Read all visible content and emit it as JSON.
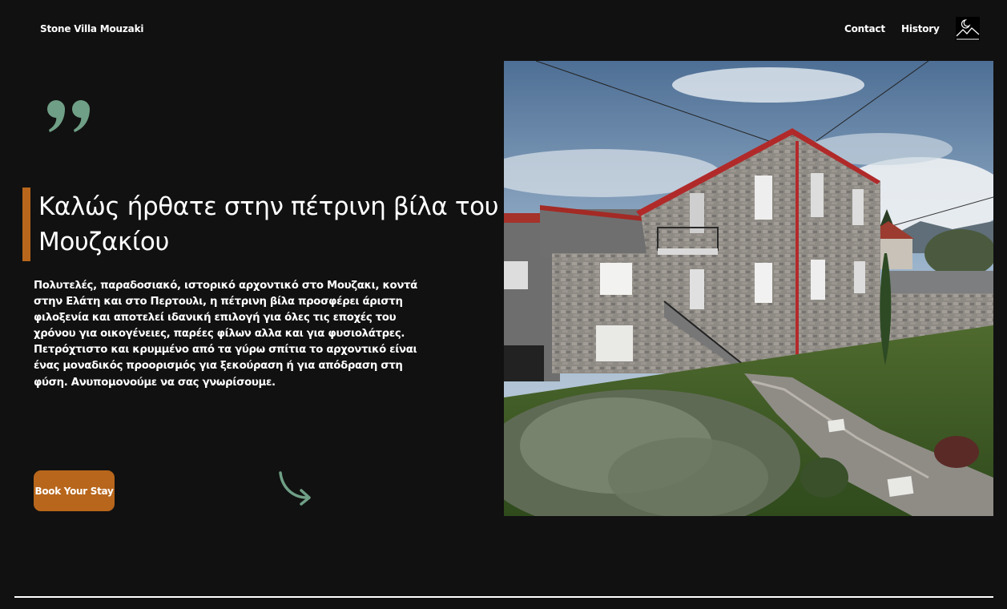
{
  "header": {
    "brand": "Stone Villa Mouzaki",
    "nav": [
      {
        "label": "Contact"
      },
      {
        "label": "History"
      }
    ],
    "theme_toggle_icon": "moon-mountain-icon"
  },
  "hero": {
    "quote_icon": "quote-icon",
    "title": "Καλώς ήρθατε στην πέτρινη βίλα του Μουζακίου",
    "description": "Πολυτελές, παραδοσιακό, ιστορικό αρχοντικό στο Μουζακι, κοντά στην Ελάτη και στο Περτουλι, η πέτρινη βίλα προσφέρει άριστη φιλοξενία και αποτελεί ιδανική επιλογή για όλες τις εποχές του χρόνου για οικογένειες, παρέες φίλων αλλα και για φυσιολάτρες. Πετρόχτιστο και κρυμμένο από τα γύρω σπίτια το αρχοντικό είναι ένας μοναδικός προορισμός για ξεκούραση ή για απόδραση στη φύση. Ανυπομονούμε να σας γνωρίσουμε.",
    "cta_label": "Book Your Stay",
    "arrow_icon": "curved-arrow-icon"
  },
  "colors": {
    "background": "#111111",
    "accent": "#b8661b",
    "icon_green": "#6f9f86",
    "text": "#ffffff"
  }
}
